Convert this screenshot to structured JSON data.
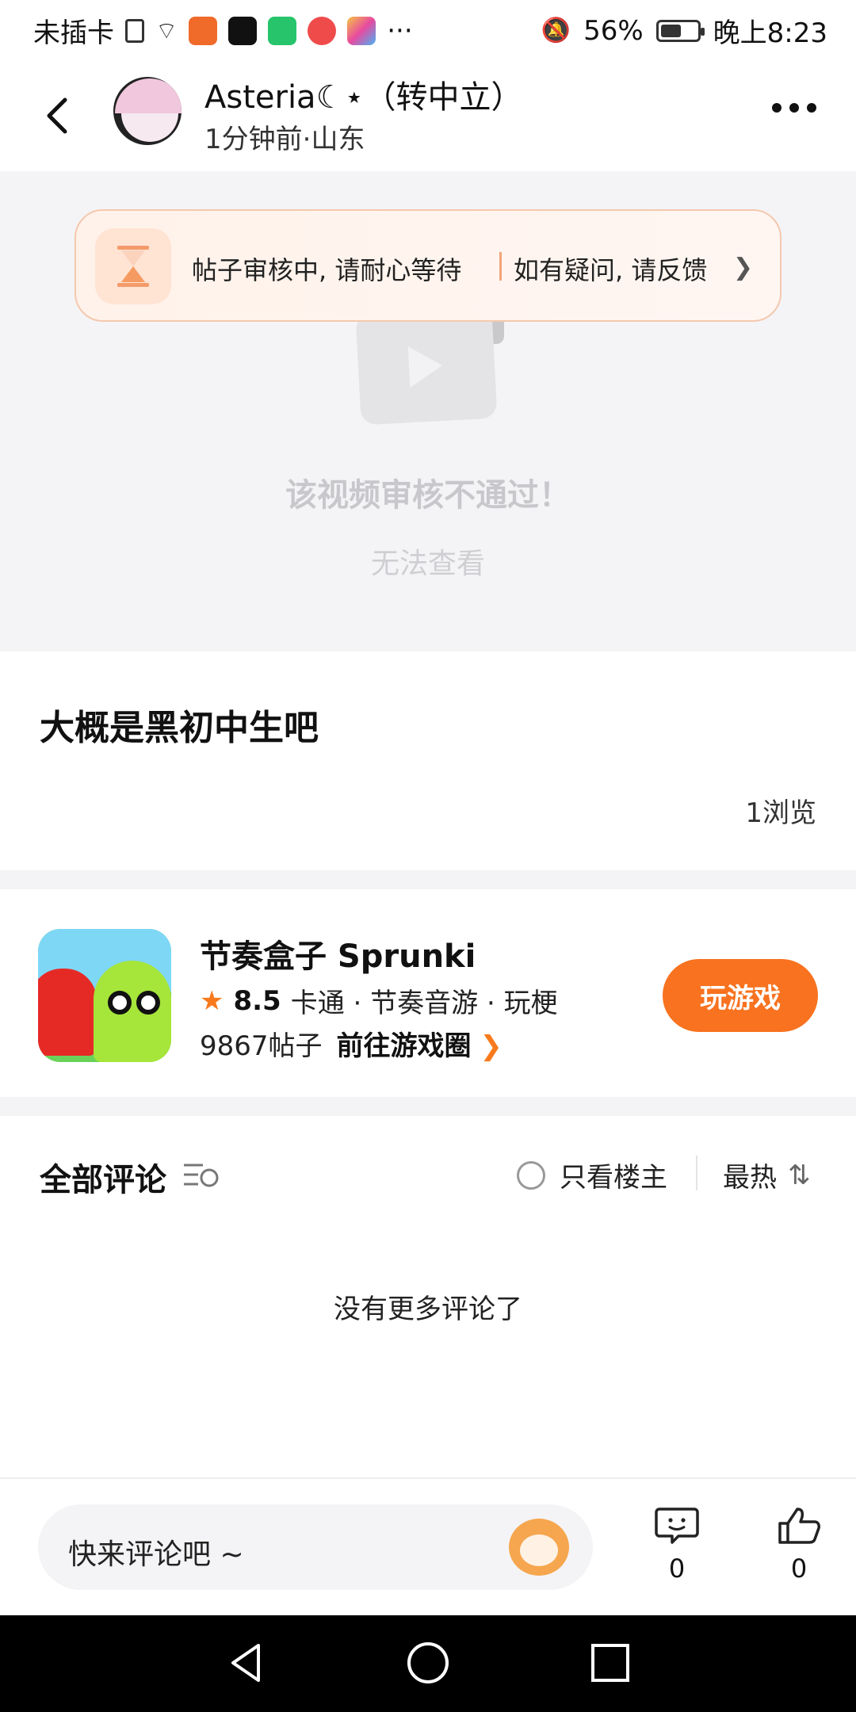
{
  "status_bar": {
    "carrier": "未插卡",
    "battery_percent": "56%",
    "battery_level": 0.56,
    "time": "晚上8:23",
    "overflow": "···"
  },
  "header": {
    "user_name": "Asteria☾⋆（转中立）",
    "post_time": "1分钟前",
    "location_sep": "·",
    "location": "山东"
  },
  "review_banner": {
    "status_text": "帖子审核中, 请耐心等待",
    "feedback_text": "如有疑问, 请反馈"
  },
  "video": {
    "fail_text": "该视频审核不通过！",
    "sub_text": "无法查看"
  },
  "post": {
    "title": "大概是黑初中生吧",
    "views": "1浏览"
  },
  "game": {
    "name": "节奏盒子 Sprunki",
    "rating": "8.5",
    "tags": "卡通 · 节奏音游 · 玩梗",
    "posts": "9867帖子",
    "goto_label": "前往游戏圈",
    "play_label": "玩游戏"
  },
  "comments": {
    "title": "全部评论",
    "only_author": "只看楼主",
    "sort": "最热",
    "empty_text": "没有更多评论了"
  },
  "bottom_bar": {
    "placeholder": "快来评论吧 ~",
    "comment_count": "0",
    "like_count": "0"
  },
  "colors": {
    "accent": "#f8721f",
    "banner_border": "#f4c8ae"
  }
}
